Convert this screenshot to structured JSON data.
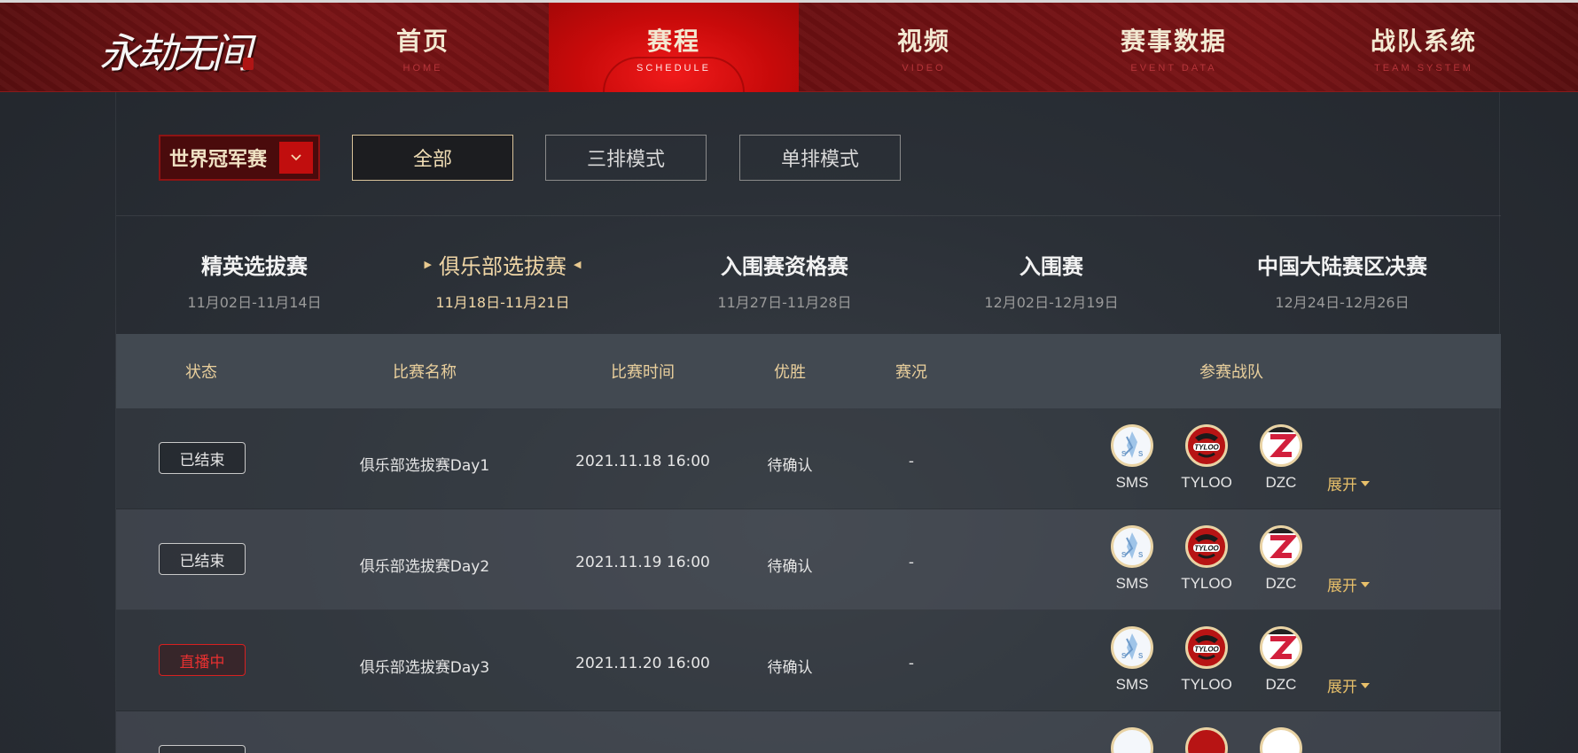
{
  "logo": {
    "text": "永劫无间"
  },
  "nav": [
    {
      "zh": "首页",
      "en": "HOME",
      "active": false
    },
    {
      "zh": "赛程",
      "en": "SCHEDULE",
      "active": true
    },
    {
      "zh": "视频",
      "en": "VIDEO",
      "active": false
    },
    {
      "zh": "赛事数据",
      "en": "EVENT DATA",
      "active": false
    },
    {
      "zh": "战队系统",
      "en": "TEAM SYSTEM",
      "active": false
    }
  ],
  "filters": {
    "tournament_select": "世界冠军赛",
    "modes": [
      "全部",
      "三排模式",
      "单排模式"
    ],
    "active_mode": "全部"
  },
  "stages": [
    {
      "name": "精英选拔赛",
      "date": "11月02日-11月14日"
    },
    {
      "name": "俱乐部选拔赛",
      "date": "11月18日-11月21日",
      "active": true
    },
    {
      "name": "入围赛资格赛",
      "date": "11月27日-11月28日"
    },
    {
      "name": "入围赛",
      "date": "12月02日-12月19日"
    },
    {
      "name": "中国大陆赛区决赛",
      "date": "12月24日-12月26日"
    }
  ],
  "table": {
    "headers": {
      "status": "状态",
      "match_name": "比赛名称",
      "match_time": "比赛时间",
      "winner": "优胜",
      "situation": "赛况",
      "teams": "参赛战队"
    },
    "expand_label": "展开",
    "rows": [
      {
        "status": "已结束",
        "live": false,
        "name": "俱乐部选拔赛Day1",
        "time": "2021.11.18 16:00",
        "winner": "待确认",
        "situation": "-",
        "teams": [
          "SMS",
          "TYLOO",
          "DZC"
        ]
      },
      {
        "status": "已结束",
        "live": false,
        "name": "俱乐部选拔赛Day2",
        "time": "2021.11.19 16:00",
        "winner": "待确认",
        "situation": "-",
        "teams": [
          "SMS",
          "TYLOO",
          "DZC"
        ]
      },
      {
        "status": "直播中",
        "live": true,
        "name": "俱乐部选拔赛Day3",
        "time": "2021.11.20 16:00",
        "winner": "待确认",
        "situation": "-",
        "teams": [
          "SMS",
          "TYLOO",
          "DZC"
        ]
      }
    ]
  },
  "colors": {
    "nav_active": "#c80a0a",
    "accent_gold": "#e9cf9c",
    "live_red": "#e83030"
  }
}
